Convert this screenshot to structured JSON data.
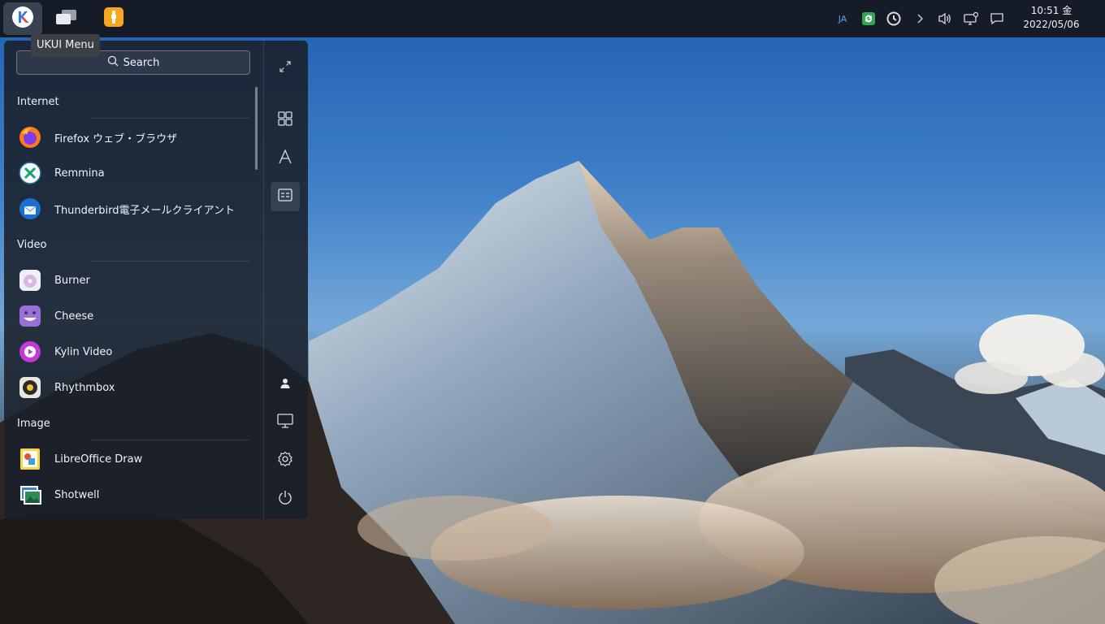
{
  "panel": {
    "tooltip": "UKUI Menu",
    "tray": {
      "input_method": "JA"
    },
    "clock": {
      "time": "10:51 金",
      "date": "2022/05/06"
    }
  },
  "menu": {
    "search_placeholder": "Search",
    "categories": [
      {
        "name": "Internet",
        "apps": [
          "Firefox ウェブ・ブラウザ",
          "Remmina",
          "Thunderbird電子メールクライアント"
        ]
      },
      {
        "name": "Video",
        "apps": [
          "Burner",
          "Cheese",
          "Kylin Video",
          "Rhythmbox"
        ]
      },
      {
        "name": "Image",
        "apps": [
          "LibreOffice Draw",
          "Shotwell"
        ]
      }
    ],
    "side_buttons": [
      "fullscreen-icon",
      "category-grid-icon",
      "letter-sort-icon",
      "function-sort-icon",
      "user-icon",
      "computer-icon",
      "settings-icon",
      "power-icon"
    ]
  },
  "colors": {
    "panel_bg": "#151c27",
    "menu_bg": "#1a202a",
    "accent_blue": "#2f7fe0"
  }
}
